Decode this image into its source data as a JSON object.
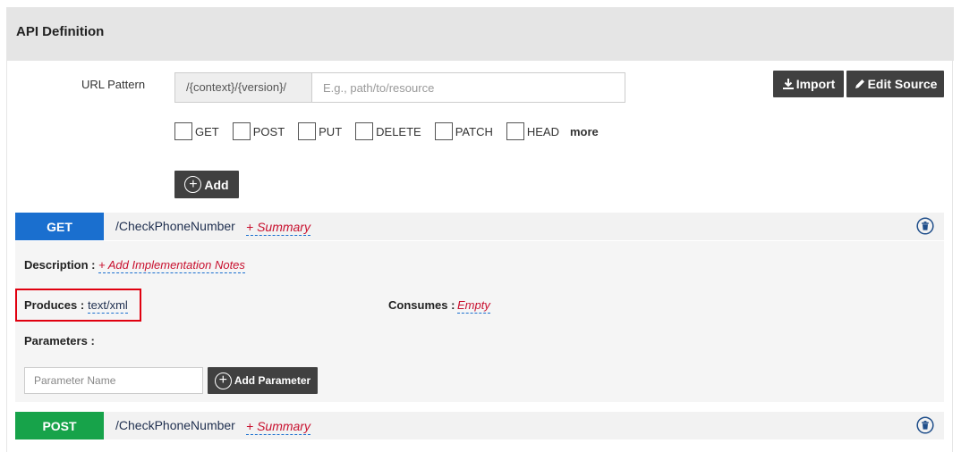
{
  "panel": {
    "title": "API Definition"
  },
  "url_pattern": {
    "label": "URL Pattern",
    "prefix": "/{context}/{version}/",
    "value": "",
    "placeholder": "E.g., path/to/resource"
  },
  "toolbar": {
    "import_label": "Import",
    "edit_source_label": "Edit Source"
  },
  "methods": [
    {
      "label": "GET",
      "checked": false
    },
    {
      "label": "POST",
      "checked": false
    },
    {
      "label": "PUT",
      "checked": false
    },
    {
      "label": "DELETE",
      "checked": false
    },
    {
      "label": "PATCH",
      "checked": false
    },
    {
      "label": "HEAD",
      "checked": false
    }
  ],
  "more_label": "more",
  "add_label": "Add",
  "resources": [
    {
      "verb": "GET",
      "path": "/CheckPhoneNumber",
      "summary": "+ Summary",
      "color": "#1a6fcf",
      "details": {
        "description_label": "Description :",
        "description_link": "+ Add Implementation Notes",
        "produces_label": "Produces :",
        "produces_value": "text/xml",
        "consumes_label": "Consumes :",
        "consumes_value": "Empty",
        "parameters_label": "Parameters :",
        "parameter_name_placeholder": "Parameter Name",
        "add_parameter_label": "Add Parameter"
      }
    },
    {
      "verb": "POST",
      "path": "/CheckPhoneNumber",
      "summary": "+ Summary",
      "color": "#17a34a"
    }
  ],
  "icons": {
    "import": "download-icon",
    "edit_source": "pencil-icon",
    "add": "circle-plus-icon",
    "delete": "trash-icon"
  },
  "colors": {
    "header_bg": "#e5e5e5",
    "dark_button": "#404040",
    "link_red": "#c8102e",
    "highlight_border": "#e0000f"
  }
}
